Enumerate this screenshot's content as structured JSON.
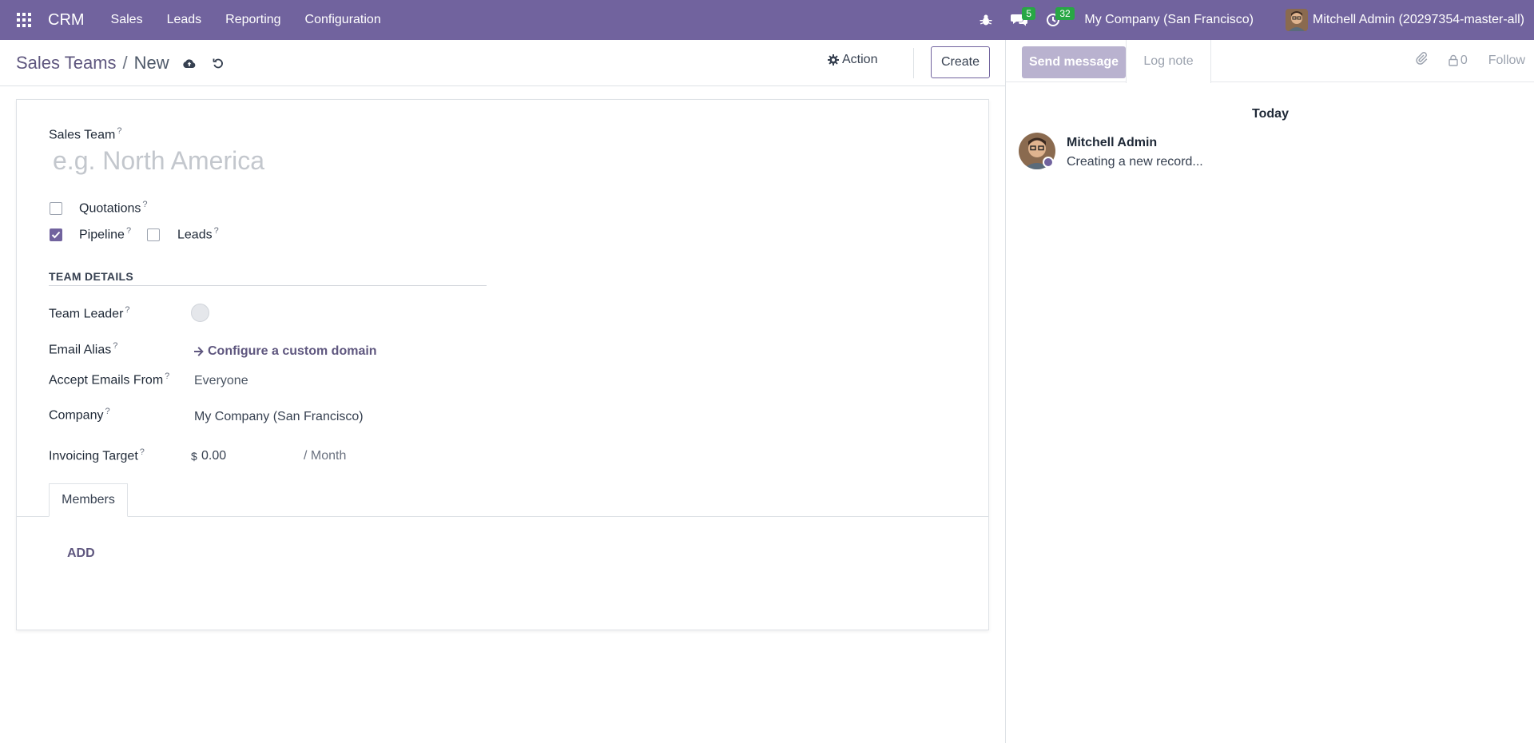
{
  "navbar": {
    "brand": "CRM",
    "menu": [
      "Sales",
      "Leads",
      "Reporting",
      "Configuration"
    ],
    "messages_count": "5",
    "activities_count": "32",
    "company": "My Company (San Francisco)",
    "user": "Mitchell Admin (20297354-master-all)"
  },
  "breadcrumb": {
    "parent": "Sales Teams",
    "separator": "/",
    "current": "New"
  },
  "control": {
    "action_label": "Action",
    "create_label": "Create"
  },
  "form": {
    "name_label": "Sales Team",
    "name_placeholder": "e.g. North America",
    "help_mark": "?",
    "quotations_label": "Quotations",
    "quotations_checked": false,
    "pipeline_label": "Pipeline",
    "pipeline_checked": true,
    "leads_label": "Leads",
    "leads_checked": false,
    "section_title": "TEAM DETAILS",
    "team_leader_label": "Team Leader",
    "email_alias_label": "Email Alias",
    "email_alias_link": "Configure a custom domain",
    "accept_emails_label": "Accept Emails From",
    "accept_emails_value": "Everyone",
    "company_label": "Company",
    "company_value": "My Company (San Francisco)",
    "invoicing_label": "Invoicing Target",
    "currency": "$",
    "invoicing_value": "0.00",
    "per_month": "/ Month",
    "tab_members": "Members",
    "add_label": "ADD"
  },
  "chatter": {
    "send_message": "Send message",
    "log_note": "Log note",
    "followers_count": "0",
    "follow": "Follow",
    "date_separator": "Today",
    "message_author": "Mitchell Admin",
    "message_body": "Creating a new record..."
  },
  "colors": {
    "brand": "#71639e",
    "badge": "#28a745"
  }
}
